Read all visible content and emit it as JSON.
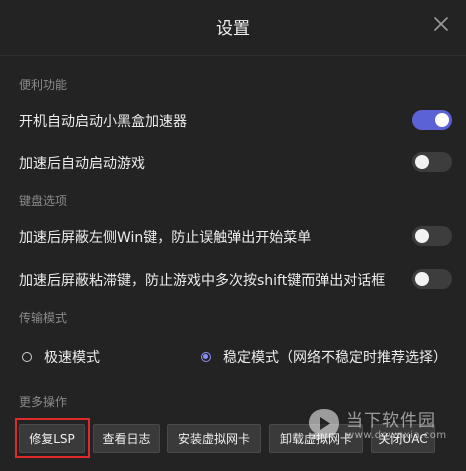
{
  "dialog": {
    "title": "设置",
    "close_icon": "close-icon"
  },
  "sections": {
    "convenience": {
      "label": "便利功能",
      "items": [
        {
          "label": "开机自动启动小黑盒加速器",
          "enabled": true
        },
        {
          "label": "加速后自动启动游戏",
          "enabled": false
        }
      ]
    },
    "keyboard": {
      "label": "键盘选项",
      "items": [
        {
          "label": "加速后屏蔽左侧Win键，防止误触弹出开始菜单",
          "enabled": false
        },
        {
          "label": "加速后屏蔽粘滞键，防止游戏中多次按shift键而弹出对话框",
          "enabled": false
        }
      ]
    },
    "transfer": {
      "label": "传输模式",
      "options": [
        {
          "label": "极速模式",
          "selected": false
        },
        {
          "label": "稳定模式（网络不稳定时推荐选择）",
          "selected": true
        }
      ]
    },
    "more": {
      "label": "更多操作",
      "buttons": [
        "修复LSP",
        "查看日志",
        "安装虚拟网卡",
        "卸载虚拟网卡",
        "关闭UAC"
      ]
    }
  },
  "watermark": {
    "text": "当下软件园",
    "url": "www.downxia.com"
  },
  "colors": {
    "accent": "#5b62d6",
    "radio_accent": "#8a90ff",
    "highlight": "#e0292b",
    "background": "#232323"
  }
}
